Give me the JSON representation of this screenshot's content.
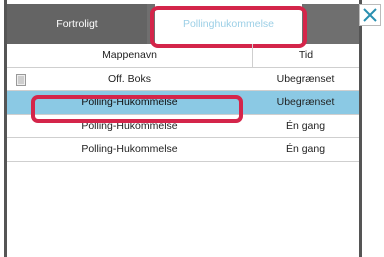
{
  "tabs": [
    {
      "label": "Fortroligt"
    },
    {
      "label": "Pollinghukommelse"
    }
  ],
  "close_icon": "close-icon",
  "table": {
    "headers": {
      "name": "Mappenavn",
      "time": "Tid"
    },
    "rows": [
      {
        "name": "Off. Boks",
        "time": "Ubegrænset",
        "icon": "document-icon"
      },
      {
        "name": "Polling-Hukommelse",
        "time": "Ubegrænset",
        "selected": true
      },
      {
        "name": "Polling-Hukommelse",
        "time": "Én gang"
      },
      {
        "name": "Polling-Hukommelse",
        "time": "Én gang"
      }
    ]
  },
  "colors": {
    "selected_row": "#8bc9e4",
    "highlight": "#d4254a",
    "active_tab_text": "#9ccfe6"
  }
}
